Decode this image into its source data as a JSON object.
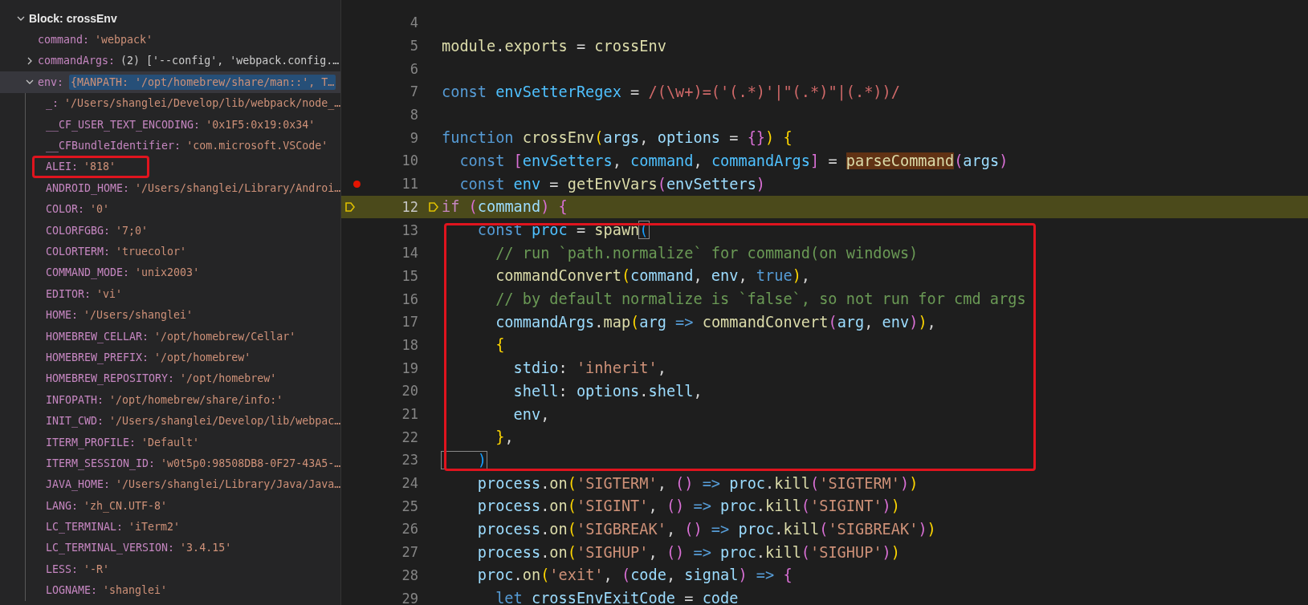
{
  "variables": {
    "scope": {
      "label": "Block: crossEnv",
      "expanded": true,
      "children": [
        {
          "name": "command:",
          "value": "'webpack'",
          "selected": false
        },
        {
          "name": "commandArgs:",
          "value": "(2) ['--config', 'webpack.config.…",
          "expanded": false,
          "selected": false
        },
        {
          "name": "env:",
          "value": "{MANPATH: '/opt/homebrew/share/man::', T…",
          "expanded": true,
          "selected": true,
          "children": [
            {
              "name": "_:",
              "value": "'/Users/shanglei/Develop/lib/webpack/node_…"
            },
            {
              "name": "__CF_USER_TEXT_ENCODING:",
              "value": "'0x1F5:0x19:0x34'"
            },
            {
              "name": "__CFBundleIdentifier:",
              "value": "'com.microsoft.VSCode'"
            },
            {
              "name": "ALEI:",
              "value": "'818'"
            },
            {
              "name": "ANDROID_HOME:",
              "value": "'/Users/shanglei/Library/Androi…"
            },
            {
              "name": "COLOR:",
              "value": "'0'"
            },
            {
              "name": "COLORFGBG:",
              "value": "'7;0'"
            },
            {
              "name": "COLORTERM:",
              "value": "'truecolor'"
            },
            {
              "name": "COMMAND_MODE:",
              "value": "'unix2003'"
            },
            {
              "name": "EDITOR:",
              "value": "'vi'"
            },
            {
              "name": "HOME:",
              "value": "'/Users/shanglei'"
            },
            {
              "name": "HOMEBREW_CELLAR:",
              "value": "'/opt/homebrew/Cellar'"
            },
            {
              "name": "HOMEBREW_PREFIX:",
              "value": "'/opt/homebrew'"
            },
            {
              "name": "HOMEBREW_REPOSITORY:",
              "value": "'/opt/homebrew'"
            },
            {
              "name": "INFOPATH:",
              "value": "'/opt/homebrew/share/info:'"
            },
            {
              "name": "INIT_CWD:",
              "value": "'/Users/shanglei/Develop/lib/webpac…"
            },
            {
              "name": "ITERM_PROFILE:",
              "value": "'Default'"
            },
            {
              "name": "ITERM_SESSION_ID:",
              "value": "'w0t5p0:98508DB8-0F27-43A5-…"
            },
            {
              "name": "JAVA_HOME:",
              "value": "'/Users/shanglei/Library/Java/Java…"
            },
            {
              "name": "LANG:",
              "value": "'zh_CN.UTF-8'"
            },
            {
              "name": "LC_TERMINAL:",
              "value": "'iTerm2'"
            },
            {
              "name": "LC_TERMINAL_VERSION:",
              "value": "'3.4.15'"
            },
            {
              "name": "LESS:",
              "value": "'-R'"
            },
            {
              "name": "LOGNAME:",
              "value": "'shanglei'"
            }
          ]
        }
      ]
    }
  },
  "editor": {
    "lines": [
      {
        "number": "4",
        "breakpoint": false,
        "current": false
      },
      {
        "number": "5",
        "breakpoint": false,
        "current": false,
        "tokens": [
          {
            "kind": "mod",
            "text": "module"
          },
          {
            "kind": "p",
            "text": "."
          },
          {
            "kind": "mod",
            "text": "exports"
          },
          {
            "kind": "p",
            "text": " = "
          },
          {
            "kind": "mod",
            "text": "crossEnv"
          }
        ]
      },
      {
        "number": "6",
        "breakpoint": false,
        "current": false
      },
      {
        "number": "7",
        "breakpoint": false,
        "current": false,
        "tokens": [
          {
            "kind": "kw",
            "text": "const "
          },
          {
            "kind": "cst",
            "text": "envSetterRegex"
          },
          {
            "kind": "p",
            "text": " = "
          },
          {
            "kind": "re",
            "text": "/(\\w+)=('(.*)'|\"(.*)\"|(.*))/"
          }
        ]
      },
      {
        "number": "8",
        "breakpoint": false,
        "current": false
      },
      {
        "number": "9",
        "breakpoint": false,
        "current": false,
        "tokens": [
          {
            "kind": "kw",
            "text": "function "
          },
          {
            "kind": "fn",
            "text": "crossEnv"
          },
          {
            "kind": "b1",
            "text": "("
          },
          {
            "kind": "var",
            "text": "args"
          },
          {
            "kind": "p",
            "text": ", "
          },
          {
            "kind": "var",
            "text": "options"
          },
          {
            "kind": "p",
            "text": " = "
          },
          {
            "kind": "b2",
            "text": "{}"
          },
          {
            "kind": "b1",
            "text": ")"
          },
          {
            "kind": "b1",
            "text": " {"
          }
        ]
      },
      {
        "number": "10",
        "breakpoint": false,
        "current": false,
        "tokens": [
          {
            "kind": "kw",
            "text": "  const "
          },
          {
            "kind": "b2",
            "text": "["
          },
          {
            "kind": "cst",
            "text": "envSetters"
          },
          {
            "kind": "p",
            "text": ", "
          },
          {
            "kind": "cst",
            "text": "command"
          },
          {
            "kind": "p",
            "text": ", "
          },
          {
            "kind": "cst",
            "text": "commandArgs"
          },
          {
            "kind": "b2",
            "text": "]"
          },
          {
            "kind": "p",
            "text": " = "
          },
          {
            "kind": "fnhl",
            "text": "parseCommand"
          },
          {
            "kind": "b2",
            "text": "("
          },
          {
            "kind": "var",
            "text": "args"
          },
          {
            "kind": "b2",
            "text": ")"
          }
        ]
      },
      {
        "number": "11",
        "breakpoint": true,
        "current": false,
        "tokens": [
          {
            "kind": "kw",
            "text": "  const "
          },
          {
            "kind": "cst",
            "text": "env"
          },
          {
            "kind": "p",
            "text": " = "
          },
          {
            "kind": "fn",
            "text": "getEnvVars"
          },
          {
            "kind": "b2",
            "text": "("
          },
          {
            "kind": "var",
            "text": "envSetters"
          },
          {
            "kind": "b2",
            "text": ")"
          }
        ]
      },
      {
        "number": "12",
        "breakpoint": false,
        "current": true,
        "tokens": [
          {
            "kind": "ctl",
            "text": "if "
          },
          {
            "kind": "b2",
            "text": "("
          },
          {
            "kind": "var",
            "text": "command"
          },
          {
            "kind": "b2",
            "text": ")"
          },
          {
            "kind": "b2",
            "text": " {"
          }
        ]
      },
      {
        "number": "13",
        "breakpoint": false,
        "current": false,
        "tokens": [
          {
            "kind": "kw",
            "text": "    const "
          },
          {
            "kind": "cst",
            "text": "proc"
          },
          {
            "kind": "p",
            "text": " = "
          },
          {
            "kind": "fn",
            "text": "spawn"
          },
          {
            "kind": "b3box",
            "text": "("
          }
        ]
      },
      {
        "number": "14",
        "breakpoint": false,
        "current": false,
        "tokens": [
          {
            "kind": "cmt",
            "text": "      // run `path.normalize` for command(on windows)"
          }
        ]
      },
      {
        "number": "15",
        "breakpoint": false,
        "current": false,
        "tokens": [
          {
            "kind": "fn",
            "text": "      commandConvert"
          },
          {
            "kind": "b1",
            "text": "("
          },
          {
            "kind": "var",
            "text": "command"
          },
          {
            "kind": "p",
            "text": ", "
          },
          {
            "kind": "var",
            "text": "env"
          },
          {
            "kind": "p",
            "text": ", "
          },
          {
            "kind": "kw",
            "text": "true"
          },
          {
            "kind": "b1",
            "text": ")"
          },
          {
            "kind": "p",
            "text": ","
          }
        ]
      },
      {
        "number": "16",
        "breakpoint": false,
        "current": false,
        "tokens": [
          {
            "kind": "cmt",
            "text": "      // by default normalize is `false`, so not run for cmd args"
          }
        ]
      },
      {
        "number": "17",
        "breakpoint": false,
        "current": false,
        "tokens": [
          {
            "kind": "var",
            "text": "      commandArgs"
          },
          {
            "kind": "p",
            "text": "."
          },
          {
            "kind": "fn",
            "text": "map"
          },
          {
            "kind": "b1",
            "text": "("
          },
          {
            "kind": "var",
            "text": "arg"
          },
          {
            "kind": "kw",
            "text": " => "
          },
          {
            "kind": "fn",
            "text": "commandConvert"
          },
          {
            "kind": "b2",
            "text": "("
          },
          {
            "kind": "var",
            "text": "arg"
          },
          {
            "kind": "p",
            "text": ", "
          },
          {
            "kind": "var",
            "text": "env"
          },
          {
            "kind": "b2",
            "text": ")"
          },
          {
            "kind": "b1",
            "text": ")"
          },
          {
            "kind": "p",
            "text": ","
          }
        ]
      },
      {
        "number": "18",
        "breakpoint": false,
        "current": false,
        "tokens": [
          {
            "kind": "b1",
            "text": "      {"
          }
        ]
      },
      {
        "number": "19",
        "breakpoint": false,
        "current": false,
        "tokens": [
          {
            "kind": "var",
            "text": "        stdio"
          },
          {
            "kind": "p",
            "text": ": "
          },
          {
            "kind": "str",
            "text": "'inherit'"
          },
          {
            "kind": "p",
            "text": ","
          }
        ]
      },
      {
        "number": "20",
        "breakpoint": false,
        "current": false,
        "tokens": [
          {
            "kind": "var",
            "text": "        shell"
          },
          {
            "kind": "p",
            "text": ": "
          },
          {
            "kind": "var",
            "text": "options"
          },
          {
            "kind": "p",
            "text": "."
          },
          {
            "kind": "var",
            "text": "shell"
          },
          {
            "kind": "p",
            "text": ","
          }
        ]
      },
      {
        "number": "21",
        "breakpoint": false,
        "current": false,
        "tokens": [
          {
            "kind": "var",
            "text": "        env"
          },
          {
            "kind": "p",
            "text": ","
          }
        ]
      },
      {
        "number": "22",
        "breakpoint": false,
        "current": false,
        "tokens": [
          {
            "kind": "b1",
            "text": "      }"
          },
          {
            "kind": "p",
            "text": ","
          }
        ]
      },
      {
        "number": "23",
        "breakpoint": false,
        "current": false,
        "tokens": [
          {
            "kind": "b3box",
            "text": "    )"
          }
        ]
      },
      {
        "number": "24",
        "breakpoint": false,
        "current": false,
        "tokens": [
          {
            "kind": "var",
            "text": "    process"
          },
          {
            "kind": "p",
            "text": "."
          },
          {
            "kind": "fn",
            "text": "on"
          },
          {
            "kind": "b1",
            "text": "("
          },
          {
            "kind": "str",
            "text": "'SIGTERM'"
          },
          {
            "kind": "p",
            "text": ", "
          },
          {
            "kind": "b2",
            "text": "()"
          },
          {
            "kind": "kw",
            "text": " => "
          },
          {
            "kind": "var",
            "text": "proc"
          },
          {
            "kind": "p",
            "text": "."
          },
          {
            "kind": "fn",
            "text": "kill"
          },
          {
            "kind": "b2",
            "text": "("
          },
          {
            "kind": "str",
            "text": "'SIGTERM'"
          },
          {
            "kind": "b2",
            "text": ")"
          },
          {
            "kind": "b1",
            "text": ")"
          }
        ]
      },
      {
        "number": "25",
        "breakpoint": false,
        "current": false,
        "tokens": [
          {
            "kind": "var",
            "text": "    process"
          },
          {
            "kind": "p",
            "text": "."
          },
          {
            "kind": "fn",
            "text": "on"
          },
          {
            "kind": "b1",
            "text": "("
          },
          {
            "kind": "str",
            "text": "'SIGINT'"
          },
          {
            "kind": "p",
            "text": ", "
          },
          {
            "kind": "b2",
            "text": "()"
          },
          {
            "kind": "kw",
            "text": " => "
          },
          {
            "kind": "var",
            "text": "proc"
          },
          {
            "kind": "p",
            "text": "."
          },
          {
            "kind": "fn",
            "text": "kill"
          },
          {
            "kind": "b2",
            "text": "("
          },
          {
            "kind": "str",
            "text": "'SIGINT'"
          },
          {
            "kind": "b2",
            "text": ")"
          },
          {
            "kind": "b1",
            "text": ")"
          }
        ]
      },
      {
        "number": "26",
        "breakpoint": false,
        "current": false,
        "tokens": [
          {
            "kind": "var",
            "text": "    process"
          },
          {
            "kind": "p",
            "text": "."
          },
          {
            "kind": "fn",
            "text": "on"
          },
          {
            "kind": "b1",
            "text": "("
          },
          {
            "kind": "str",
            "text": "'SIGBREAK'"
          },
          {
            "kind": "p",
            "text": ", "
          },
          {
            "kind": "b2",
            "text": "()"
          },
          {
            "kind": "kw",
            "text": " => "
          },
          {
            "kind": "var",
            "text": "proc"
          },
          {
            "kind": "p",
            "text": "."
          },
          {
            "kind": "fn",
            "text": "kill"
          },
          {
            "kind": "b2",
            "text": "("
          },
          {
            "kind": "str",
            "text": "'SIGBREAK'"
          },
          {
            "kind": "b2",
            "text": ")"
          },
          {
            "kind": "b1",
            "text": ")"
          }
        ]
      },
      {
        "number": "27",
        "breakpoint": false,
        "current": false,
        "tokens": [
          {
            "kind": "var",
            "text": "    process"
          },
          {
            "kind": "p",
            "text": "."
          },
          {
            "kind": "fn",
            "text": "on"
          },
          {
            "kind": "b1",
            "text": "("
          },
          {
            "kind": "str",
            "text": "'SIGHUP'"
          },
          {
            "kind": "p",
            "text": ", "
          },
          {
            "kind": "b2",
            "text": "()"
          },
          {
            "kind": "kw",
            "text": " => "
          },
          {
            "kind": "var",
            "text": "proc"
          },
          {
            "kind": "p",
            "text": "."
          },
          {
            "kind": "fn",
            "text": "kill"
          },
          {
            "kind": "b2",
            "text": "("
          },
          {
            "kind": "str",
            "text": "'SIGHUP'"
          },
          {
            "kind": "b2",
            "text": ")"
          },
          {
            "kind": "b1",
            "text": ")"
          }
        ]
      },
      {
        "number": "28",
        "breakpoint": false,
        "current": false,
        "tokens": [
          {
            "kind": "var",
            "text": "    proc"
          },
          {
            "kind": "p",
            "text": "."
          },
          {
            "kind": "fn",
            "text": "on"
          },
          {
            "kind": "b1",
            "text": "("
          },
          {
            "kind": "str",
            "text": "'exit'"
          },
          {
            "kind": "p",
            "text": ", "
          },
          {
            "kind": "b2",
            "text": "("
          },
          {
            "kind": "var",
            "text": "code"
          },
          {
            "kind": "p",
            "text": ", "
          },
          {
            "kind": "var",
            "text": "signal"
          },
          {
            "kind": "b2",
            "text": ")"
          },
          {
            "kind": "kw",
            "text": " => "
          },
          {
            "kind": "b2",
            "text": "{"
          }
        ]
      },
      {
        "number": "29",
        "breakpoint": false,
        "current": false,
        "tokens": [
          {
            "kind": "kw",
            "text": "      let "
          },
          {
            "kind": "var",
            "text": "crossEnvExitCode"
          },
          {
            "kind": "p",
            "text": " = "
          },
          {
            "kind": "var",
            "text": "code"
          }
        ]
      }
    ]
  }
}
